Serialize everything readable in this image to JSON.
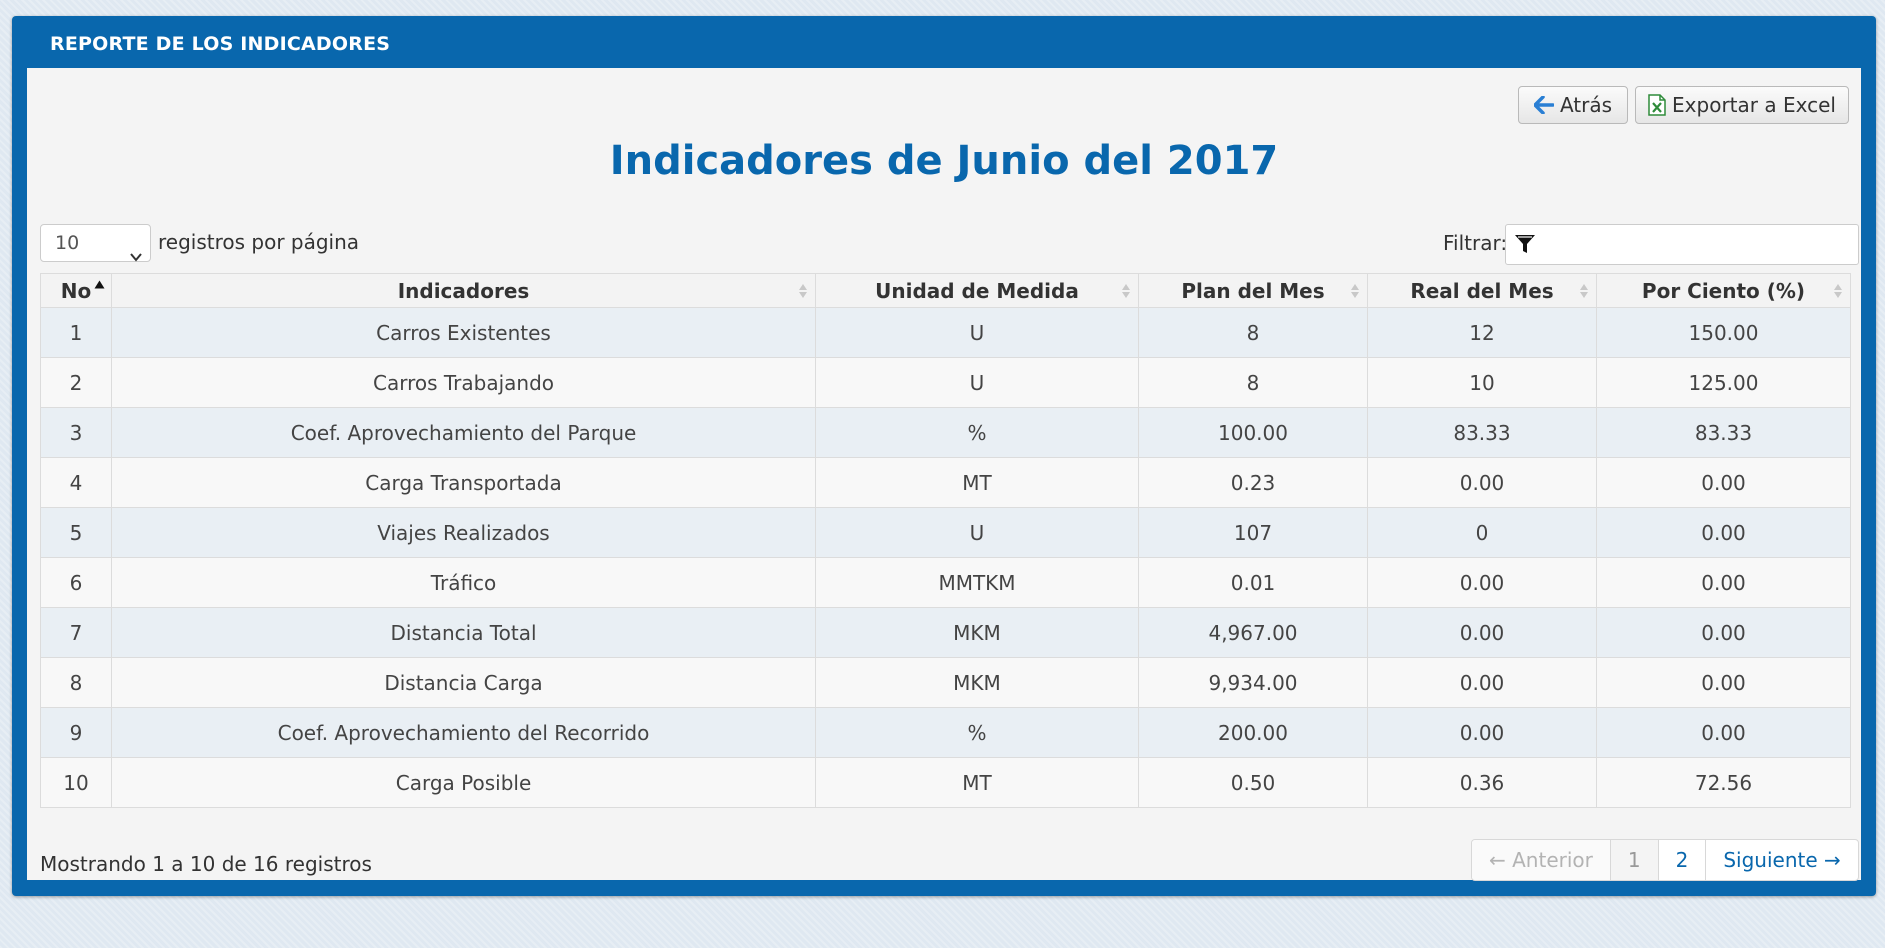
{
  "panel": {
    "title": "REPORTE DE LOS INDICADORES"
  },
  "toolbar": {
    "back_label": "Atrás",
    "export_label": "Exportar a Excel"
  },
  "page": {
    "heading": "Indicadores de Junio del 2017"
  },
  "length": {
    "value": "10",
    "label": "registros por página"
  },
  "filter": {
    "label": "Filtrar:",
    "value": ""
  },
  "table": {
    "headers": [
      "No",
      "Indicadores",
      "Unidad de Medida",
      "Plan del Mes",
      "Real del Mes",
      "Por Ciento (%)"
    ],
    "rows": [
      [
        "1",
        "Carros Existentes",
        "U",
        "8",
        "12",
        "150.00"
      ],
      [
        "2",
        "Carros Trabajando",
        "U",
        "8",
        "10",
        "125.00"
      ],
      [
        "3",
        "Coef. Aprovechamiento del Parque",
        "%",
        "100.00",
        "83.33",
        "83.33"
      ],
      [
        "4",
        "Carga Transportada",
        "MT",
        "0.23",
        "0.00",
        "0.00"
      ],
      [
        "5",
        "Viajes Realizados",
        "U",
        "107",
        "0",
        "0.00"
      ],
      [
        "6",
        "Tráfico",
        "MMTKM",
        "0.01",
        "0.00",
        "0.00"
      ],
      [
        "7",
        "Distancia Total",
        "MKM",
        "4,967.00",
        "0.00",
        "0.00"
      ],
      [
        "8",
        "Distancia Carga",
        "MKM",
        "9,934.00",
        "0.00",
        "0.00"
      ],
      [
        "9",
        "Coef. Aprovechamiento del Recorrido",
        "%",
        "200.00",
        "0.00",
        "0.00"
      ],
      [
        "10",
        "Carga Posible",
        "MT",
        "0.50",
        "0.36",
        "72.56"
      ]
    ]
  },
  "footer": {
    "info": "Mostrando 1 a 10 de 16 registros",
    "prev": "← Anterior",
    "pages": [
      "1",
      "2"
    ],
    "next": "Siguiente →"
  },
  "icons": {
    "back": "arrow-left-icon",
    "export": "excel-icon",
    "filter": "funnel-icon",
    "sort": "sort-icon"
  },
  "colors": {
    "brand": "#0967ad",
    "heading": "#0967ad",
    "stripe": "#e9eff4"
  }
}
